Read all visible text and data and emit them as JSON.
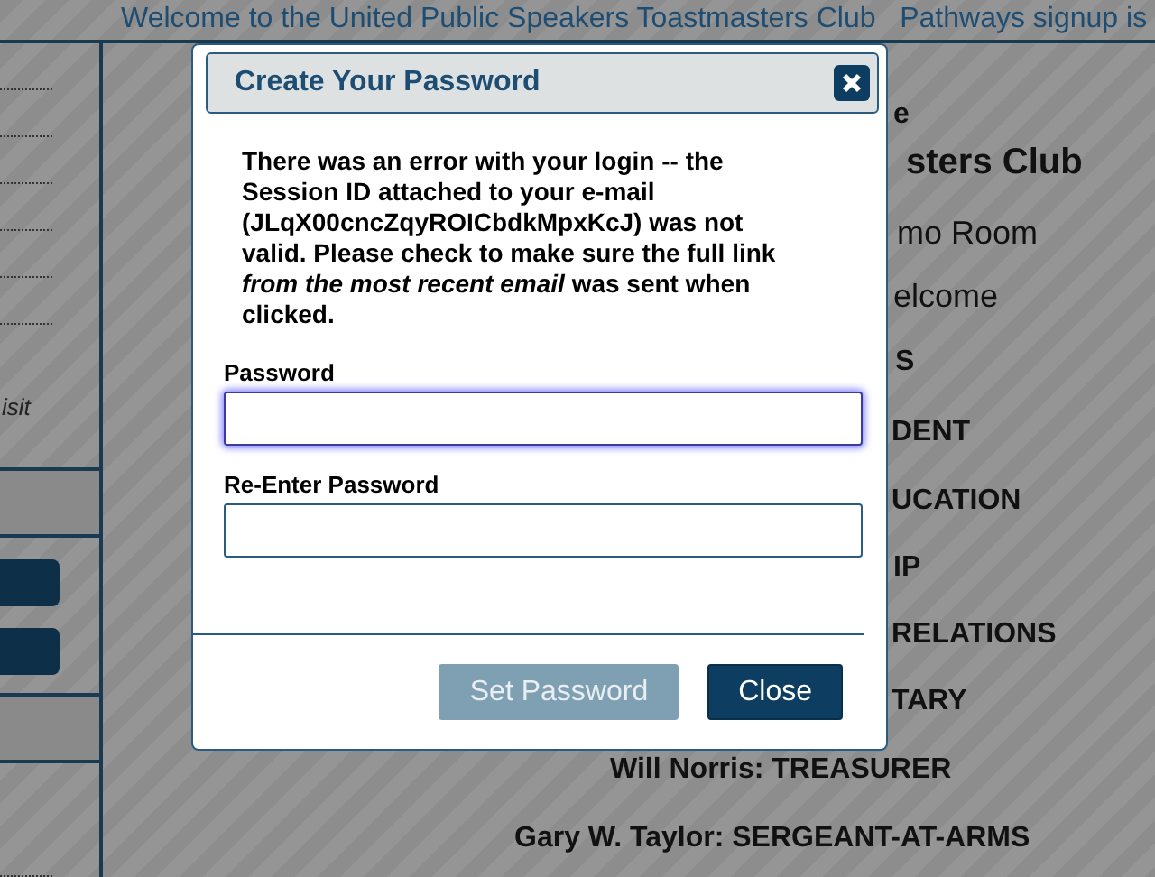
{
  "page_header": {
    "text": "Welcome to the United Public Speakers Toastmasters Club   Pathways signup is"
  },
  "sidebar": {
    "note": "isit"
  },
  "content": {
    "fragments": [
      "e",
      "sters Club",
      "mo Room",
      "elcome",
      "S",
      "DENT",
      "UCATION",
      "IP",
      "RELATIONS",
      "TARY"
    ],
    "officers": [
      "Will Norris: TREASURER",
      "Gary W. Taylor: SERGEANT-AT-ARMS"
    ]
  },
  "dialog": {
    "title": "Create Your Password",
    "message": "There was an error with your login -- the Session ID attached to your e-mail (JLqX00cncZqyROICbdkMpxKcJ) was not valid. Please check to make sure the full link *from the most recent email* was sent when clicked.",
    "fields": [
      {
        "label": "Password",
        "focused": true
      },
      {
        "label": "Re-Enter Password",
        "focused": false
      }
    ],
    "buttons": [
      {
        "label": "Set Password",
        "disabled": true
      },
      {
        "label": "Close",
        "disabled": false
      }
    ]
  }
}
